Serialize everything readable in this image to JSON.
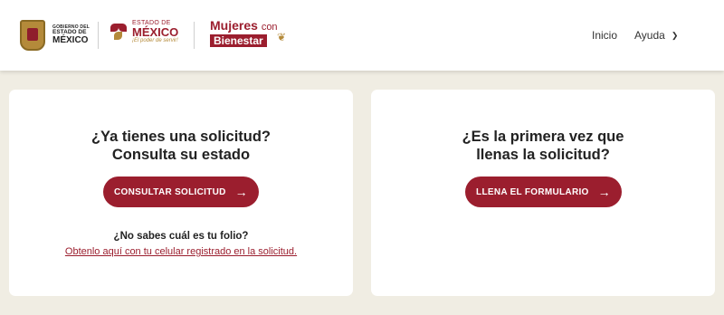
{
  "colors": {
    "brand": "#9b1e2e",
    "gold": "#b48a3a",
    "background": "#f0ede3"
  },
  "header": {
    "gob_logo": {
      "line1": "GOBIERNO DEL",
      "line2": "ESTADO DE",
      "line3": "MÉXICO",
      "icon": "state-shield-icon"
    },
    "edo_logo": {
      "line1": "ESTADO DE",
      "line2": "MÉXICO",
      "slogan": "¡El poder de servir!",
      "icon": "flower-icon"
    },
    "program_logo": {
      "line1": "Mujeres",
      "line1_suffix": "con",
      "line2": "Bienestar",
      "icon": "laurel-icon"
    },
    "nav": {
      "inicio": "Inicio",
      "ayuda": "Ayuda",
      "ayuda_icon": "chevron-down-icon"
    }
  },
  "cards": {
    "consulta": {
      "title_line1": "¿Ya tienes una solicitud?",
      "title_line2": "Consulta su estado",
      "button": "CONSULTAR SOLICITUD",
      "button_icon": "arrow-right-icon",
      "folio_question": "¿No sabes cuál es tu folio?",
      "folio_link": "Obtenlo aquí con tu celular registrado en la solicitud."
    },
    "nueva": {
      "title_line1": "¿Es la primera vez que",
      "title_line2": "llenas la solicitud?",
      "button": "LLENA EL FORMULARIO",
      "button_icon": "arrow-right-icon"
    }
  }
}
